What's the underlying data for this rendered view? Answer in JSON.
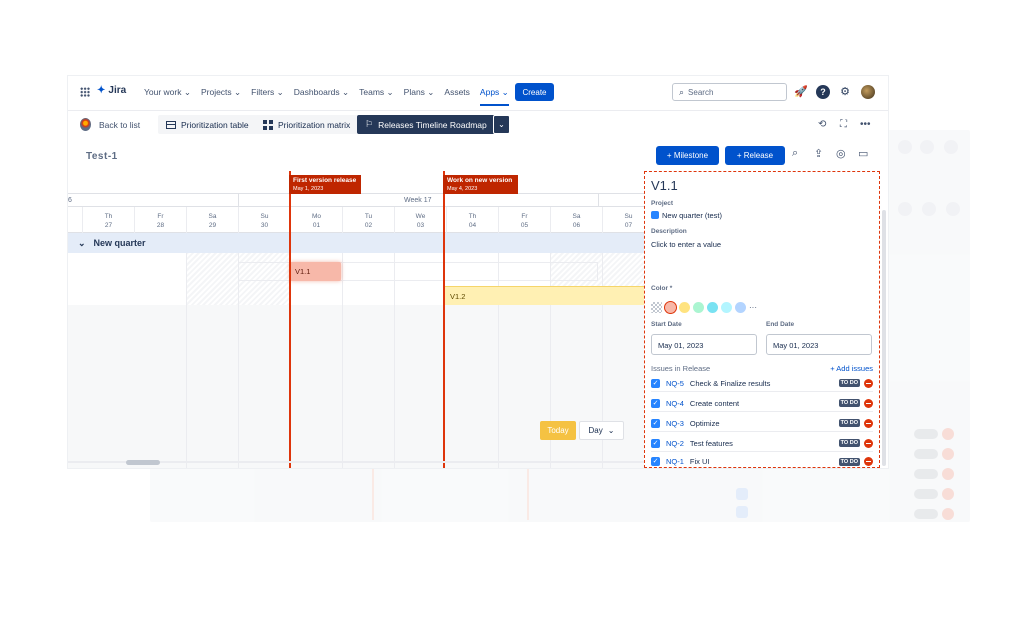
{
  "nav": {
    "logo": "Jira",
    "items": [
      "Your work ⌄",
      "Projects ⌄",
      "Filters ⌄",
      "Dashboards ⌄",
      "Teams ⌄",
      "Plans ⌄",
      "Assets",
      "Apps ⌄"
    ],
    "create_label": "Create",
    "search_placeholder": "Search"
  },
  "toolbar": {
    "back_label": "Back to list",
    "tabs": [
      "Prioritization table",
      "Prioritization matrix",
      "Releases Timeline Roadmap"
    ]
  },
  "project_title": "Test-1",
  "actions": {
    "milestone": "+ Milestone",
    "release": "+ Release"
  },
  "timeline": {
    "prev_week": "6",
    "week": "Week 17",
    "days": [
      {
        "d": "Th",
        "n": "27"
      },
      {
        "d": "Fr",
        "n": "28"
      },
      {
        "d": "Sa",
        "n": "29"
      },
      {
        "d": "Su",
        "n": "30"
      },
      {
        "d": "Mo",
        "n": "01"
      },
      {
        "d": "Tu",
        "n": "02"
      },
      {
        "d": "We",
        "n": "03"
      },
      {
        "d": "Th",
        "n": "04"
      },
      {
        "d": "Fr",
        "n": "05"
      },
      {
        "d": "Sa",
        "n": "06"
      },
      {
        "d": "Su",
        "n": "07"
      }
    ],
    "group": "New quarter",
    "milestones": [
      {
        "title": "First version release",
        "date": "May 1, 2023"
      },
      {
        "title": "Work on new version",
        "date": "May 4, 2023"
      }
    ],
    "releases": [
      "V1.1",
      "V1.2"
    ],
    "today_label": "Today",
    "zoom_label": "Day"
  },
  "panel": {
    "title": "V1.1",
    "project_label": "Project",
    "project_value": "New quarter (test)",
    "description_label": "Description",
    "description_placeholder": "Click to enter a value",
    "color_label": "Color *",
    "colors": [
      "#f7b8a9",
      "#ffe380",
      "#abf5d1",
      "#79e2f2",
      "#b3d4ff"
    ],
    "start_label": "Start Date",
    "start_value": "May 01, 2023",
    "end_label": "End Date",
    "end_value": "May 01, 2023",
    "issues_label": "Issues in Release",
    "add_issues": "+ Add issues",
    "status": "TO DO",
    "issues": [
      {
        "key": "NQ-5",
        "summary": "Check & Finalize results"
      },
      {
        "key": "NQ-4",
        "summary": "Create content"
      },
      {
        "key": "NQ-3",
        "summary": "Optimize"
      },
      {
        "key": "NQ-2",
        "summary": "Test features"
      },
      {
        "key": "NQ-1",
        "summary": "Fix UI"
      }
    ]
  }
}
